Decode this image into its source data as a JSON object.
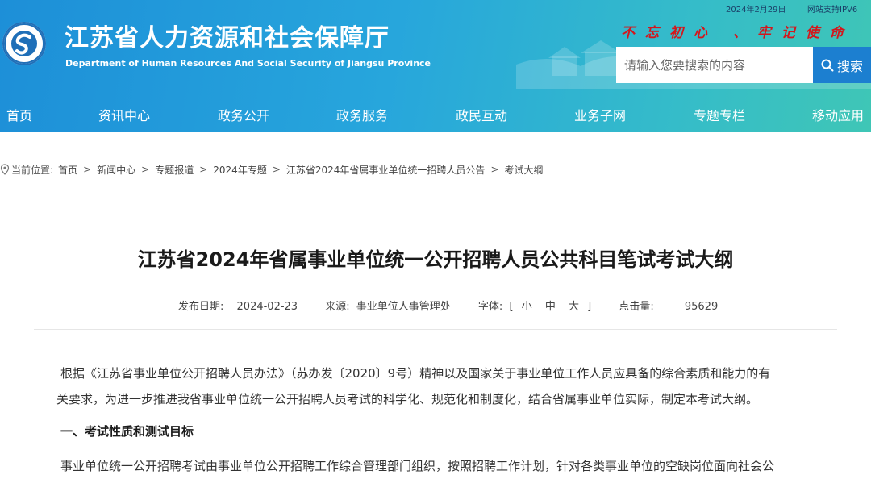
{
  "topbar": {
    "date": "2024年2月29日",
    "ipv6": "网站支持IPV6"
  },
  "site": {
    "title": "江苏省人力资源和社会保障厅",
    "subtitle": "Department of Human Resources And Social Security of Jiangsu Province",
    "slogan": "不忘初心 、牢记使命",
    "brand_color": "#1d8fd8",
    "accent_color": "#d4161c"
  },
  "search": {
    "placeholder": "请输入您要搜索的内容",
    "button_label": "搜索",
    "icon": "search-icon"
  },
  "nav": {
    "items": [
      {
        "label": "首页"
      },
      {
        "label": "资讯中心"
      },
      {
        "label": "政务公开"
      },
      {
        "label": "政务服务"
      },
      {
        "label": "政民互动"
      },
      {
        "label": "业务子网"
      },
      {
        "label": "专题专栏"
      },
      {
        "label": "移动应用"
      }
    ]
  },
  "breadcrumb": {
    "prefix": "当前位置:",
    "items": [
      "首页",
      "新闻中心",
      "专题报道",
      "2024年专题",
      "江苏省2024年省属事业单位统一招聘人员公告",
      "考试大纲"
    ],
    "separator": ">",
    "icon": "location-pin-icon"
  },
  "article": {
    "title": "江苏省2024年省属事业单位统一公开招聘人员公共科目笔试考试大纲",
    "meta": {
      "date_label": "发布日期:",
      "date": "2024-02-23",
      "source_label": "来源:",
      "source": "事业单位人事管理处",
      "font_label": "字体:",
      "font_open": "[",
      "font_small": "小",
      "font_medium": "中",
      "font_large": "大",
      "font_close": "]",
      "views_label": "点击量:",
      "views": "95629"
    },
    "p1_line1": "根据《江苏省事业单位公开招聘人员办法》（苏办发〔2020〕9号）精神以及国家关于事业单位工作人员应具备的综合素质和能力的有",
    "p1_line2": "关要求，为进一步推进我省事业单位统一公开招聘人员考试的科学化、规范化和制度化，结合省属事业单位实际，制定本考试大纲。",
    "section1_heading": "一、考试性质和测试目标",
    "p2_line1": "事业单位统一公开招聘考试由事业单位公开招聘工作综合管理部门组织，按照招聘工作计划，针对各类事业单位的空缺岗位面向社会公"
  }
}
